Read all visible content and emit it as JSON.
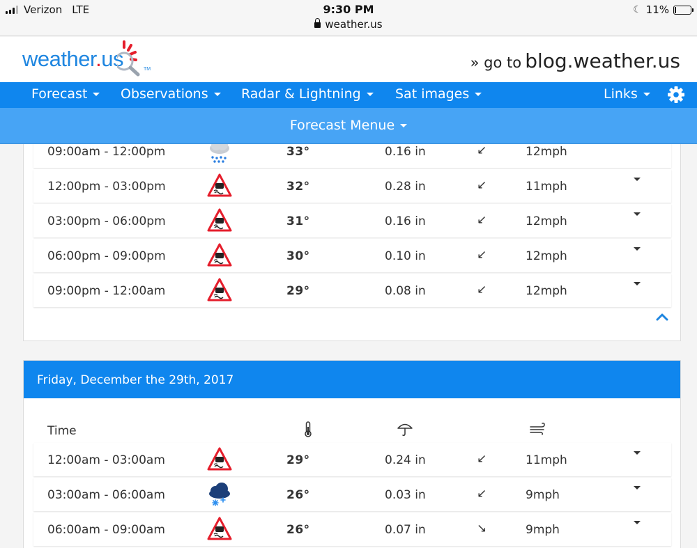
{
  "status_bar": {
    "carrier": "Verizon",
    "network": "LTE",
    "time": "9:30 PM",
    "url": "weather.us",
    "battery": "11%",
    "battery_level": 0.11
  },
  "header": {
    "logo_main": "weather",
    "logo_dot": ".",
    "logo_tail": "us",
    "logo_tm": "TM",
    "blog_prefix": "» go to",
    "blog_host": "blog.weather.us"
  },
  "nav": {
    "items": [
      {
        "label": "Forecast"
      },
      {
        "label": "Observations"
      },
      {
        "label": "Radar & Lightning"
      },
      {
        "label": "Sat images"
      },
      {
        "label": "Links"
      }
    ]
  },
  "subnav": {
    "label": "Forecast Menue"
  },
  "day1": {
    "rows": [
      {
        "time": "09:00am - 12:00pm",
        "icon": "rain-cloud-icon",
        "temp": "33°",
        "precip": "0.16 in",
        "dir": "↙",
        "wind": "12mph"
      },
      {
        "time": "12:00pm - 03:00pm",
        "icon": "slippery-road-warning-icon",
        "temp": "32°",
        "precip": "0.28 in",
        "dir": "↙",
        "wind": "11mph"
      },
      {
        "time": "03:00pm - 06:00pm",
        "icon": "slippery-road-warning-icon",
        "temp": "31°",
        "precip": "0.16 in",
        "dir": "↙",
        "wind": "12mph"
      },
      {
        "time": "06:00pm - 09:00pm",
        "icon": "slippery-road-warning-icon",
        "temp": "30°",
        "precip": "0.10 in",
        "dir": "↙",
        "wind": "12mph"
      },
      {
        "time": "09:00pm - 12:00am",
        "icon": "slippery-road-warning-icon",
        "temp": "29°",
        "precip": "0.08 in",
        "dir": "↙",
        "wind": "12mph"
      }
    ]
  },
  "day2": {
    "title": "Friday, December the 29th, 2017",
    "col_time": "Time",
    "rows": [
      {
        "time": "12:00am - 03:00am",
        "icon": "slippery-road-warning-icon",
        "temp": "29°",
        "precip": "0.24 in",
        "dir": "↙",
        "wind": "11mph"
      },
      {
        "time": "03:00am - 06:00am",
        "icon": "snow-cloud-icon",
        "temp": "26°",
        "precip": "0.03 in",
        "dir": "↙",
        "wind": "9mph"
      },
      {
        "time": "06:00am - 09:00am",
        "icon": "slippery-road-warning-icon",
        "temp": "26°",
        "precip": "0.07 in",
        "dir": "↘",
        "wind": "9mph"
      }
    ]
  },
  "colors": {
    "nav_blue": "#0f86ee",
    "subnav_blue": "#47a4f5",
    "logo_red": "#e51e2c"
  }
}
